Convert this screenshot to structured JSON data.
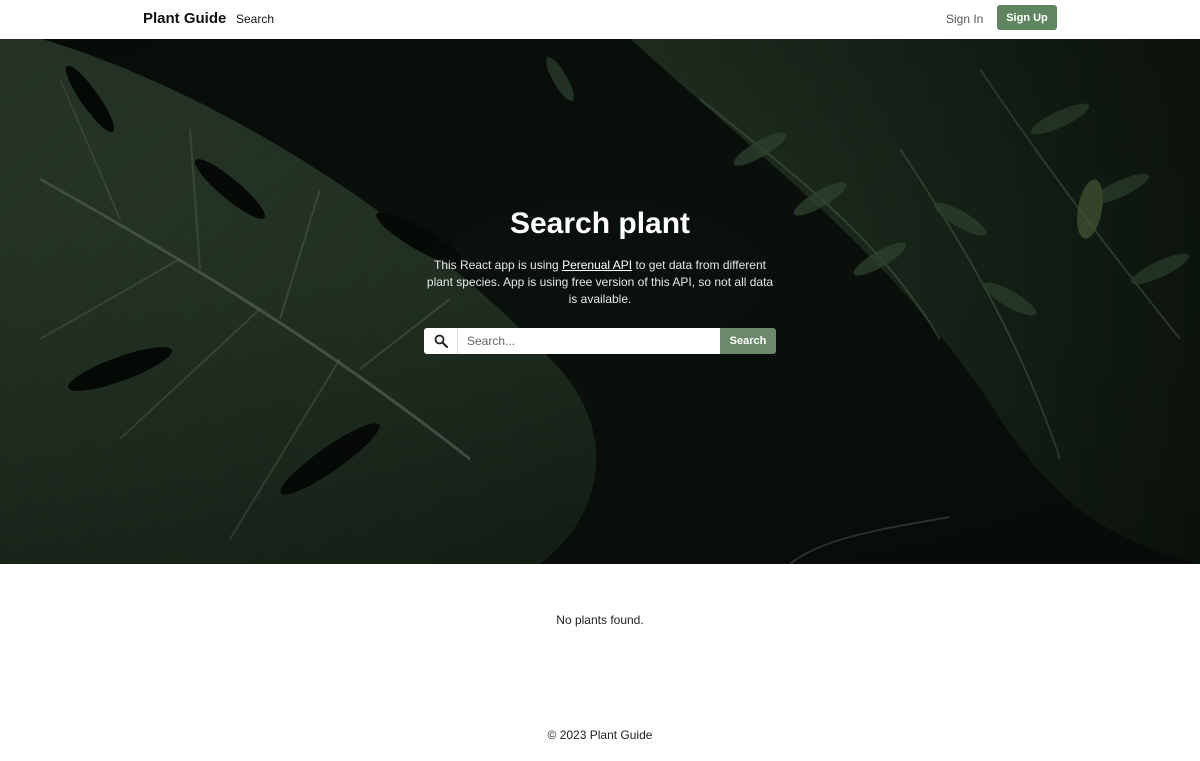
{
  "navbar": {
    "brand": "Plant Guide",
    "links": [
      "Search"
    ],
    "sign_in": "Sign In",
    "sign_up": "Sign Up"
  },
  "hero": {
    "title": "Search plant",
    "description_before": "This React app is using ",
    "api_link": "Perenual API",
    "description_after": " to get data from different plant species. App is using free version of this API, so not all data is available.",
    "search": {
      "placeholder": "Search...",
      "value": "",
      "button": "Search",
      "icon": "search-icon"
    }
  },
  "results": {
    "empty_message": "No plants found."
  },
  "footer": {
    "copyright": "© 2023 Plant Guide"
  },
  "colors": {
    "accent": "#5f8661",
    "search_button": "#6a8a6a",
    "hero_overlay": "#0c1410"
  }
}
